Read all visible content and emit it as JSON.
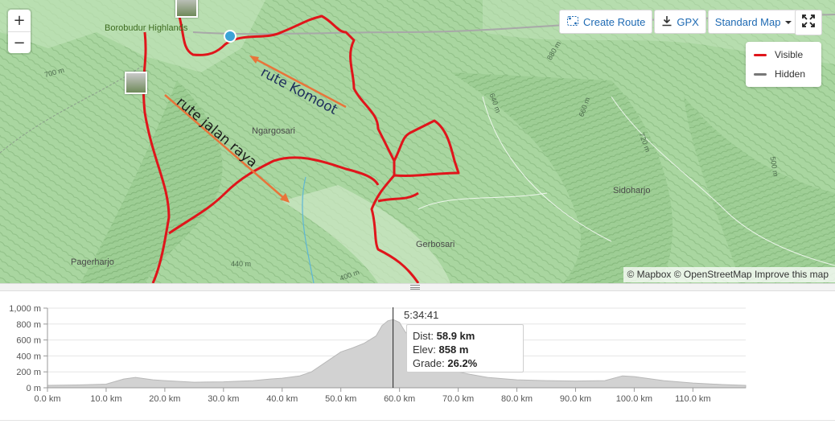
{
  "map": {
    "zoom_in": "+",
    "zoom_out": "−",
    "places": {
      "borobudur": "Borobudur Highlands",
      "ngargosari": "Ngargosari",
      "sidoharjo": "Sidoharjo",
      "gerbosari": "Gerbosari",
      "pagerharjo": "Pagerharjo"
    },
    "contours": {
      "c700": "700 m",
      "c880": "880 m",
      "c640": "640 m",
      "c660": "660 m",
      "c720": "720 m",
      "c500": "500 m",
      "c440": "440 m",
      "c400": "400 m"
    },
    "annotations": {
      "komoot": "rute Komoot",
      "jalan_raya": "rute jalan raya"
    },
    "attribution": {
      "mapbox": "© Mapbox",
      "osm": "© OpenStreetMap",
      "improve": "Improve this map"
    },
    "route_color": "#e0151b",
    "arrow_color": "#e8743a",
    "start_marker_color": "#3ba3d6"
  },
  "toolbar": {
    "create_route": "Create Route",
    "gpx": "GPX",
    "map_type": "Standard Map"
  },
  "legend": {
    "visible": "Visible",
    "hidden": "Hidden",
    "visible_color": "#e0151b",
    "hidden_color": "#777777"
  },
  "chart_data": {
    "type": "area",
    "title": "",
    "xlabel": "",
    "ylabel": "",
    "x_unit": "km",
    "y_unit": "m",
    "xlim": [
      0,
      119
    ],
    "ylim": [
      0,
      1000
    ],
    "x_ticks": [
      "0.0 km",
      "10.0 km",
      "20.0 km",
      "30.0 km",
      "40.0 km",
      "50.0 km",
      "60.0 km",
      "70.0 km",
      "80.0 km",
      "90.0 km",
      "100.0 km",
      "110.0 km"
    ],
    "y_ticks": [
      "0 m",
      "200 m",
      "400 m",
      "600 m",
      "800 m",
      "1,000 m"
    ],
    "x_tick_values": [
      0,
      10,
      20,
      30,
      40,
      50,
      60,
      70,
      80,
      90,
      100,
      110
    ],
    "y_tick_values": [
      0,
      200,
      400,
      600,
      800,
      1000
    ],
    "series": [
      {
        "x": [
          0,
          5,
          10,
          13,
          15,
          18,
          20,
          25,
          30,
          35,
          38,
          40,
          43,
          45,
          47,
          49,
          50,
          52,
          54,
          56,
          57,
          58,
          58.9,
          60,
          61,
          63,
          65,
          67,
          68,
          70,
          72,
          75,
          80,
          85,
          90,
          95,
          98,
          100,
          103,
          105,
          110,
          115,
          119
        ],
        "y": [
          30,
          35,
          45,
          110,
          130,
          100,
          90,
          70,
          75,
          90,
          110,
          120,
          150,
          200,
          300,
          400,
          450,
          500,
          560,
          650,
          780,
          840,
          858,
          820,
          700,
          550,
          420,
          300,
          240,
          200,
          170,
          130,
          100,
          90,
          85,
          90,
          150,
          140,
          110,
          90,
          60,
          40,
          30
        ]
      }
    ],
    "cursor": {
      "time": "5:34:41",
      "dist_label": "Dist:",
      "dist": "58.9 km",
      "elev_label": "Elev:",
      "elev": "858 m",
      "grade_label": "Grade:",
      "grade": "26.2%",
      "x": 58.9
    },
    "grid": true
  }
}
